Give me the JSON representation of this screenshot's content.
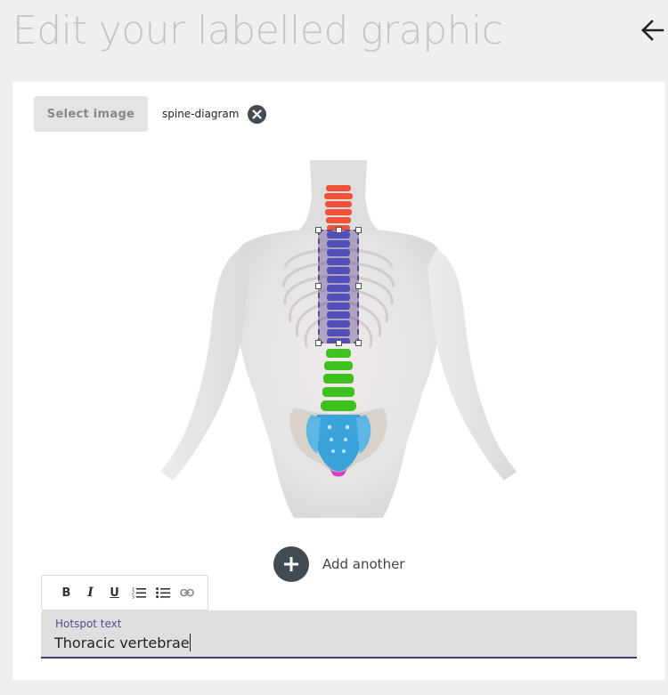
{
  "header": {
    "title": "Edit your labelled graphic",
    "back_icon": "arrow-left-icon"
  },
  "image_picker": {
    "select_label": "Select image",
    "file_name": "spine-diagram",
    "remove_icon": "close-circle-icon"
  },
  "diagram": {
    "hotspot_active": true,
    "spine_colors": {
      "cervical": "#f0533a",
      "thoracic": "#4a56d8",
      "lumbar": "#3ec01e",
      "sacrum": "#3aa3dc",
      "coccyx": "#d83ac0"
    }
  },
  "actions": {
    "add_label": "Add another",
    "add_icon": "plus-icon"
  },
  "editor": {
    "toolbar": {
      "bold": "B",
      "italic": "I",
      "underline": "U"
    },
    "field_label": "Hotspot text",
    "field_value": "Thoracic vertebrae"
  },
  "colors": {
    "accent": "#4b3a78",
    "button_dark": "#424a52"
  }
}
